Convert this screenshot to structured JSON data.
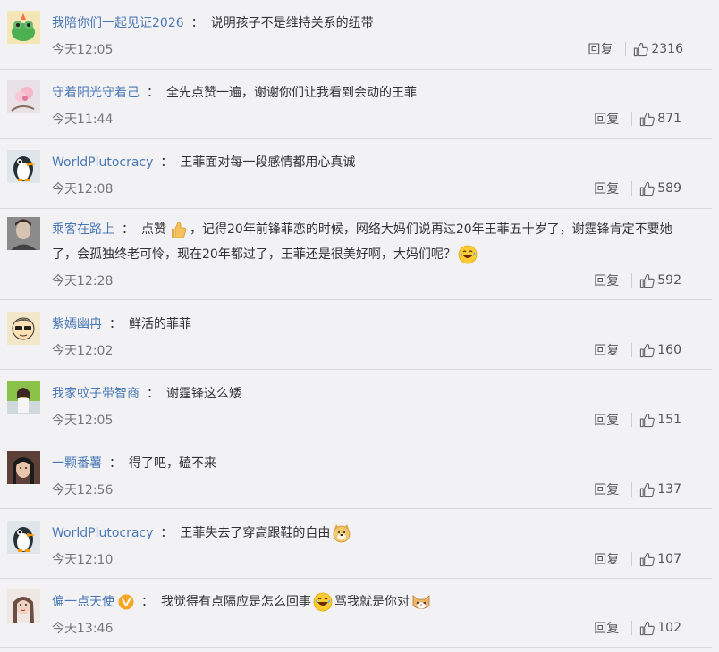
{
  "comments": [
    {
      "user": "我陪你们一起见证2026",
      "sep": "：",
      "text": "说明孩子不是维持关系的纽带",
      "time": "今天12:05",
      "reply": "回复",
      "likes": "2316",
      "avatar": "green-frog-avatar"
    },
    {
      "user": "守着阳光守着己",
      "sep": "：",
      "text": "全先点赞一遍，谢谢你们让我看到会动的王菲",
      "time": "今天11:44",
      "reply": "回复",
      "likes": "871",
      "avatar": "pink-flower-avatar"
    },
    {
      "user": "WorldPlutocracy",
      "sep": "：",
      "text": "王菲面对每一段感情都用心真诚",
      "time": "今天12:08",
      "reply": "回复",
      "likes": "589",
      "avatar": "penguin-avatar"
    },
    {
      "user": "乘客在路上",
      "sep": "：",
      "text_before_emoji": "点赞",
      "text": "，记得20年前锋菲恋的时候，网络大妈们说再过20年王菲五十岁了，谢霆锋肯定不要她了，会孤独终老可怜，现在20年都过了，王菲还是很美好啊，大妈们呢？",
      "time": "今天12:28",
      "reply": "回复",
      "likes": "592",
      "avatar": "man-photo-avatar",
      "emoji_1": "thumbs-up-emoji",
      "emoji_2": "laughing-emoji"
    },
    {
      "user": "紫嫣幽冉",
      "sep": "：",
      "text": "鲜活的菲菲",
      "time": "今天12:02",
      "reply": "回复",
      "likes": "160",
      "avatar": "cartoon-sunglasses-avatar"
    },
    {
      "user": "我家蚊子带智商",
      "sep": "：",
      "text": "谢霆锋这么矮",
      "time": "今天12:05",
      "reply": "回复",
      "likes": "151",
      "avatar": "girl-outdoor-avatar"
    },
    {
      "user": "一颗番薯",
      "sep": "：",
      "text": "得了吧，磕不来",
      "time": "今天12:56",
      "reply": "回复",
      "likes": "137",
      "avatar": "dark-hair-avatar"
    },
    {
      "user": "WorldPlutocracy",
      "sep": "：",
      "text": "王菲失去了穿高跟鞋的自由",
      "time": "今天12:10",
      "reply": "回复",
      "likes": "107",
      "avatar": "penguin-avatar",
      "emoji_1": "doge-emoji"
    },
    {
      "user": "偏一点天使",
      "sep": "：",
      "text": "我觉得有点隔应是怎么回事",
      "text_after_emoji": "骂我就是你对",
      "time": "今天13:46",
      "reply": "回复",
      "likes": "102",
      "avatar": "girl-portrait-avatar",
      "badge": "verified-v-icon",
      "emoji_1": "laughing-emoji",
      "emoji_2": "cat-emoji"
    }
  ],
  "colors": {
    "username": "#4a78b5",
    "text": "#333333",
    "time": "#777777",
    "background": "#f2f2f5",
    "verified": "#f5a623"
  }
}
